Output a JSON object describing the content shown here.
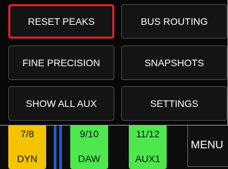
{
  "menu": {
    "buttons": [
      {
        "label": "RESET PEAKS",
        "selected": true
      },
      {
        "label": "BUS ROUTING",
        "selected": false
      },
      {
        "label": "FINE PRECISION",
        "selected": false
      },
      {
        "label": "SNAPSHOTS",
        "selected": false
      },
      {
        "label": "SHOW ALL AUX",
        "selected": false
      },
      {
        "label": "SETTINGS",
        "selected": false
      }
    ],
    "highlight_color": "#e0202c"
  },
  "channels": [
    {
      "number": "7/8",
      "name": "DYN",
      "color": "#f5c400"
    },
    {
      "number": "9/10",
      "name": "DAW",
      "color": "#4ee84e"
    },
    {
      "number": "11/12",
      "name": "AUX1",
      "color": "#4ee84e"
    }
  ],
  "menu_key_label": "MENU"
}
